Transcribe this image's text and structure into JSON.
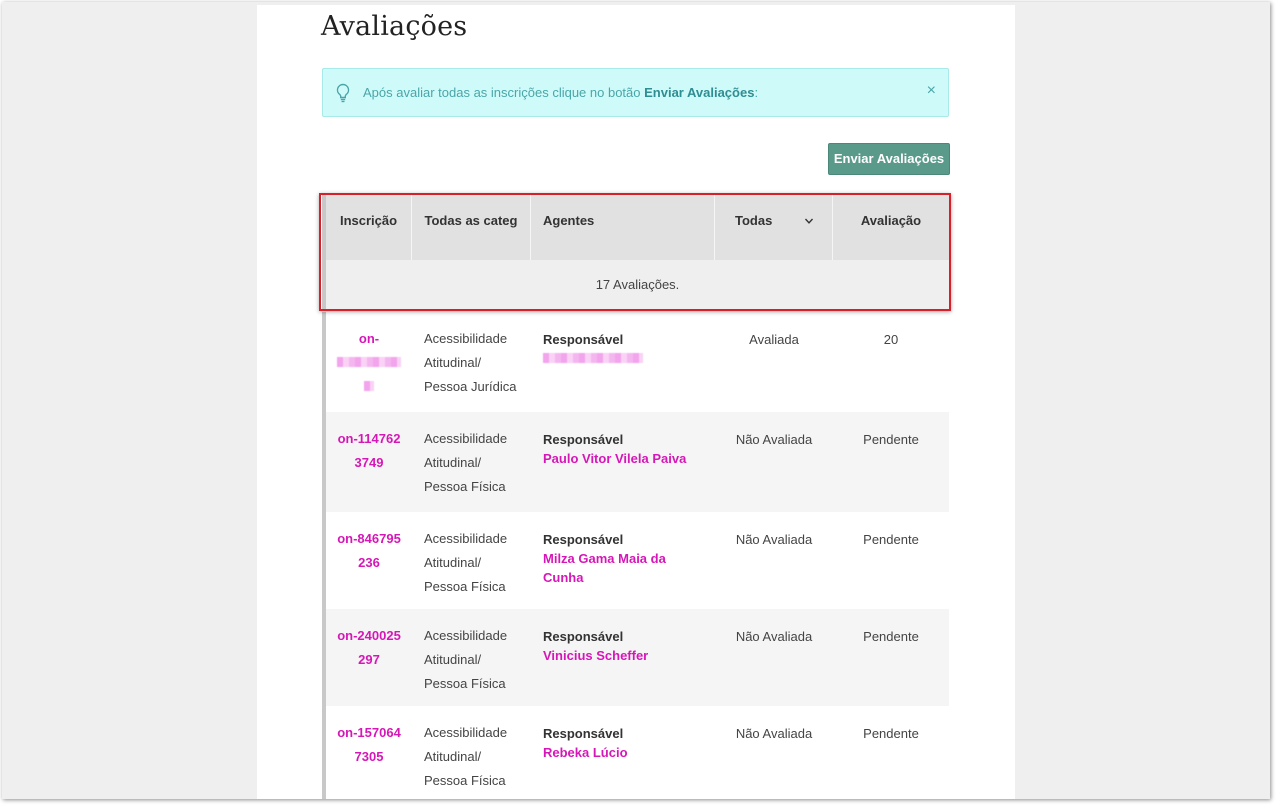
{
  "page": {
    "title": "Avaliações"
  },
  "alert": {
    "icon": "lightbulb-icon",
    "message_prefix": "Após avaliar todas as inscrições clique no botão ",
    "message_strong": "Enviar Avaliações",
    "message_suffix": ":",
    "close": "×"
  },
  "actions": {
    "send_label": "Enviar Avaliações"
  },
  "table": {
    "headers": {
      "registration": "Inscrição",
      "category": "Todas as categ",
      "agents": "Agentes",
      "status_filter": "Todas",
      "evaluation": "Avaliação"
    },
    "summary": "17 Avaliações.",
    "rows": [
      {
        "registration": "on-",
        "category": "Acessibilidade Atitudinal/ Pessoa Jurídica",
        "role": "Responsável",
        "agent": "",
        "status": "Avaliada",
        "evaluation": "20"
      },
      {
        "registration": "on-1147623749",
        "category": "Acessibilidade Atitudinal/ Pessoa Física",
        "role": "Responsável",
        "agent": "Paulo Vitor Vilela Paiva",
        "status": "Não Avaliada",
        "evaluation": "Pendente"
      },
      {
        "registration": "on-846795236",
        "category": "Acessibilidade Atitudinal/ Pessoa Física",
        "role": "Responsável",
        "agent": "Milza Gama Maia da Cunha",
        "status": "Não Avaliada",
        "evaluation": "Pendente"
      },
      {
        "registration": "on-240025297",
        "category": "Acessibilidade Atitudinal/ Pessoa Física",
        "role": "Responsável",
        "agent": "Vinicius Scheffer",
        "status": "Não Avaliada",
        "evaluation": "Pendente"
      },
      {
        "registration": "on-1570647305",
        "category": "Acessibilidade Atitudinal/ Pessoa Física",
        "role": "Responsável",
        "agent": "Rebeka Lúcio",
        "status": "Não Avaliada",
        "evaluation": "Pendente"
      }
    ]
  },
  "colors": {
    "accent_pink": "#d617b8",
    "button_green": "#5a9a8a",
    "alert_bg": "#cffafa",
    "alert_text": "#4aa6a8",
    "highlight_red": "#d8202a"
  }
}
